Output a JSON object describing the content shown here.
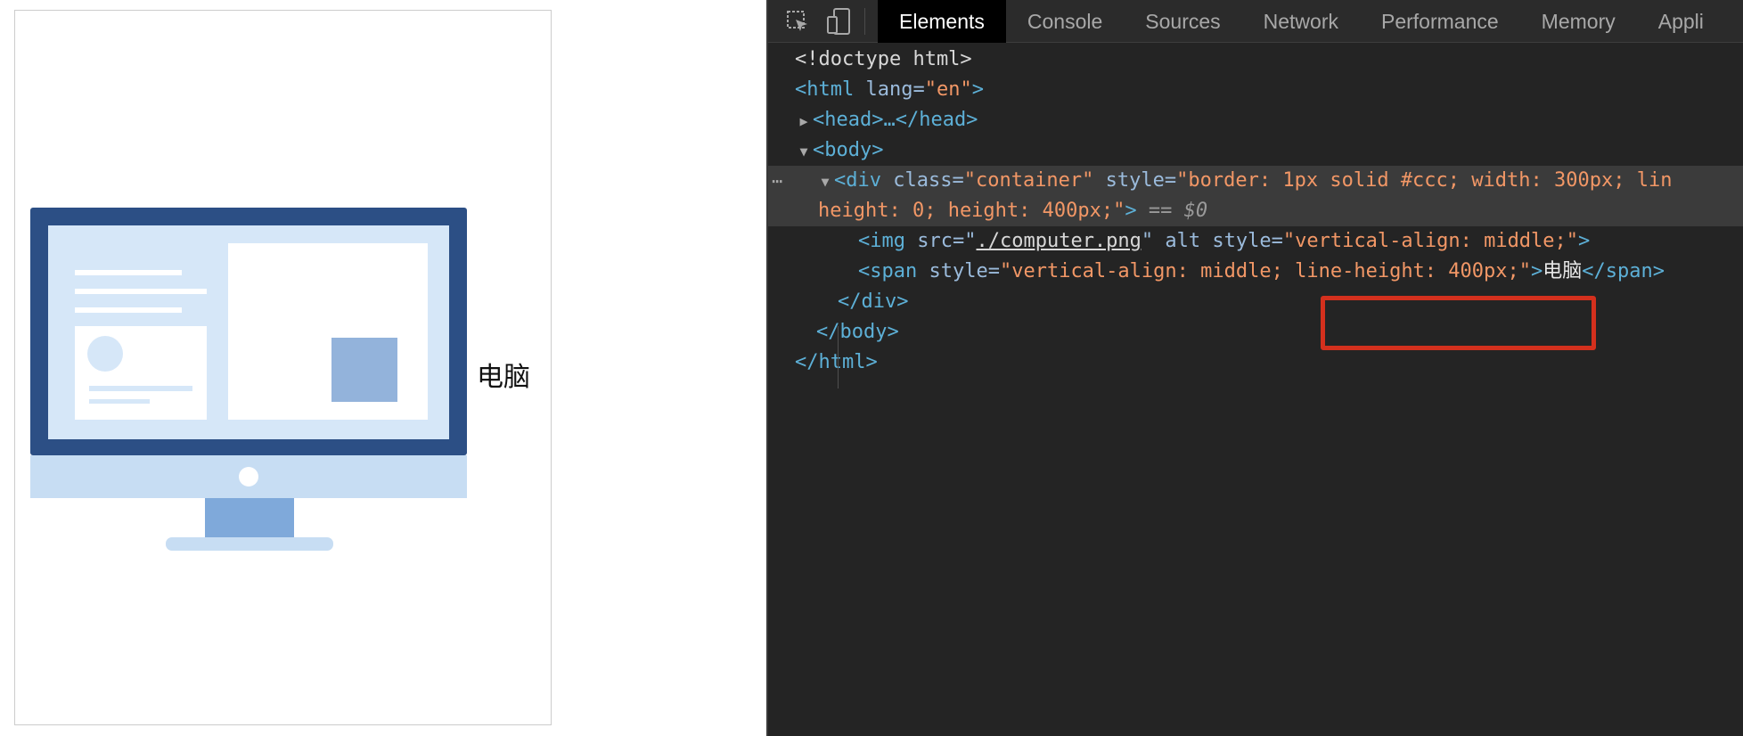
{
  "page": {
    "caption": "电脑"
  },
  "devtools": {
    "tabs": [
      "Elements",
      "Console",
      "Sources",
      "Network",
      "Performance",
      "Memory",
      "Appli"
    ],
    "active_tab": "Elements",
    "tree": {
      "doctype": "<!doctype html>",
      "html_open_tag": "<html",
      "html_lang_attr": "lang",
      "html_lang_value": "\"en\"",
      "html_open_close": ">",
      "head_collapsed": "<head>…</head>",
      "body_open": "<body>",
      "div_open": "<div",
      "div_class_attr": "class",
      "div_class_value": "\"container\"",
      "div_style_attr": "style",
      "div_style_value_line1": "\"border: 1px solid #ccc; width: 300px; lin",
      "div_style_value_line2": "height: 0; height: 400px;\"",
      "div_tag_close": ">",
      "selected_marker": "== $0",
      "img_open": "<img",
      "img_src_attr": "src",
      "img_src_value": "./computer.png",
      "img_alt_attr": "alt",
      "img_style_attr": "style",
      "img_style_value": "\"vertical-align: middle;\"",
      "img_close": ">",
      "span_open": "<span",
      "span_style_attr": "style",
      "span_style_value_a": "\"vertical-align: middle;",
      "span_style_value_b": "line-height: 400px;\"",
      "span_text": "电脑",
      "span_close": "</span>",
      "div_close": "</div>",
      "body_close": "</body>",
      "html_close": "</html>"
    }
  },
  "colors": {
    "devtools_bg": "#242424",
    "tag": "#5db0d7",
    "attr_value": "#f29766",
    "highlight": "#d4301d",
    "monitor_frame": "#2c4f85",
    "monitor_screen": "#d6e7f8",
    "monitor_stand": "#7fa9da"
  },
  "icons": [
    "inspect-element-icon",
    "device-toolbar-icon",
    "computer-illustration"
  ]
}
